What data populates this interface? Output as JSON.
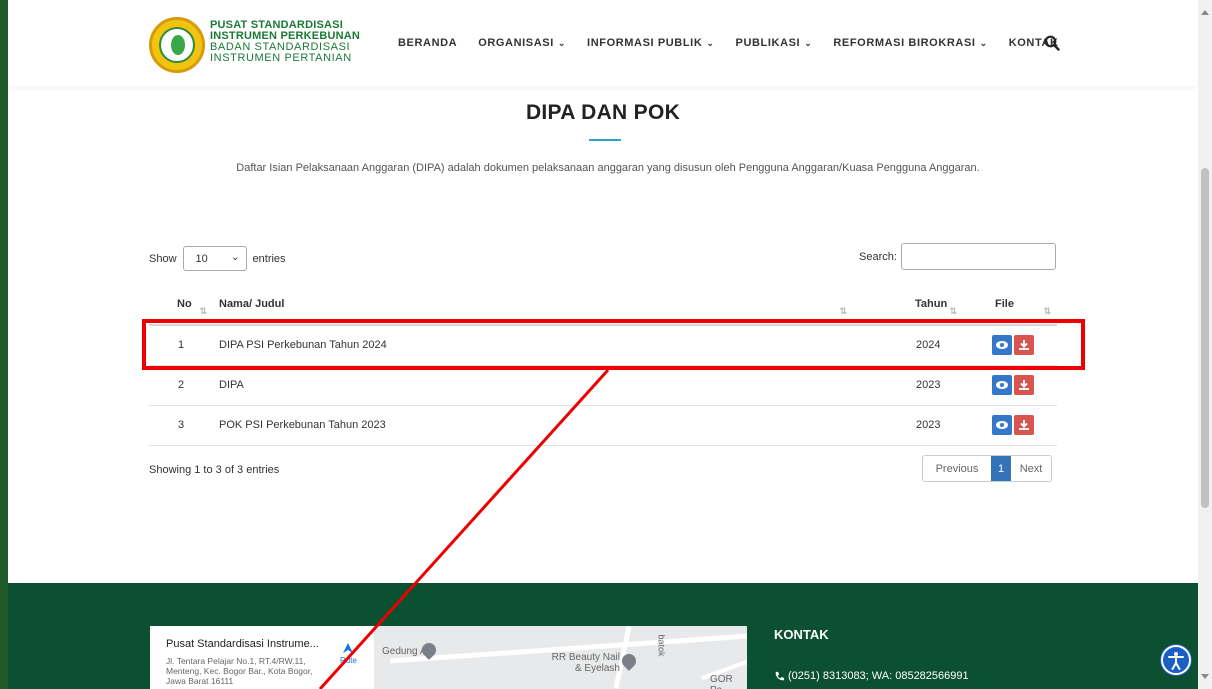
{
  "brand": {
    "line1": "PUSAT STANDARDISASI",
    "line2": "INSTRUMEN PERKEBUNAN",
    "line3": "BADAN STANDARDISASI",
    "line4": "INSTRUMEN PERTANIAN"
  },
  "nav": {
    "items": [
      {
        "label": "BERANDA",
        "has_dropdown": false
      },
      {
        "label": "ORGANISASI",
        "has_dropdown": true
      },
      {
        "label": "INFORMASI PUBLIK",
        "has_dropdown": true
      },
      {
        "label": "PUBLIKASI",
        "has_dropdown": true
      },
      {
        "label": "REFORMASI BIROKRASI",
        "has_dropdown": true
      },
      {
        "label": "KONTAK",
        "has_dropdown": false
      }
    ],
    "search_icon": "search-icon"
  },
  "page": {
    "title": "DIPA DAN POK",
    "description": "Daftar Isian Pelaksanaan Anggaran (DIPA) adalah dokumen pelaksanaan anggaran yang disusun oleh Pengguna Anggaran/Kuasa Pengguna Anggaran."
  },
  "table_controls": {
    "show_label": "Show",
    "page_length": "10",
    "entries_label": "entries",
    "search_label": "Search:",
    "search_value": ""
  },
  "table": {
    "columns": [
      "No",
      "Nama/ Judul",
      "Tahun",
      "File"
    ],
    "rows": [
      {
        "no": "1",
        "nama": "DIPA PSI Perkebunan Tahun 2024",
        "tahun": "2024"
      },
      {
        "no": "2",
        "nama": "DIPA",
        "tahun": "2023"
      },
      {
        "no": "3",
        "nama": "POK PSI Perkebunan Tahun 2023",
        "tahun": "2023"
      }
    ]
  },
  "pagination": {
    "info": "Showing 1 to 3 of 3 entries",
    "previous": "Previous",
    "current": "1",
    "next": "Next"
  },
  "footer": {
    "map": {
      "place_name": "Pusat Standardisasi Instrume...",
      "address": "Jl. Tentara Pelajar No.1, RT.4/RW.11, Menteng, Kec. Bogor Bar., Kota Bogor, Jawa Barat 16111",
      "route_label": "Rute",
      "label_a": "Gedung A",
      "label_b": "RR Beauty Nail & Eyelash",
      "label_c": "GOR Pa",
      "label_d": "batok"
    },
    "kontak_title": "KONTAK",
    "phone": "(0251) 8313083; WA: 085282566991"
  },
  "colors": {
    "brand_green": "#1a7a35",
    "footer_green": "#0b5031",
    "accent_blue": "#26a7c9",
    "view_button": "#3477c8",
    "download_button": "#d9534f",
    "annotation_red": "#ee0000"
  }
}
